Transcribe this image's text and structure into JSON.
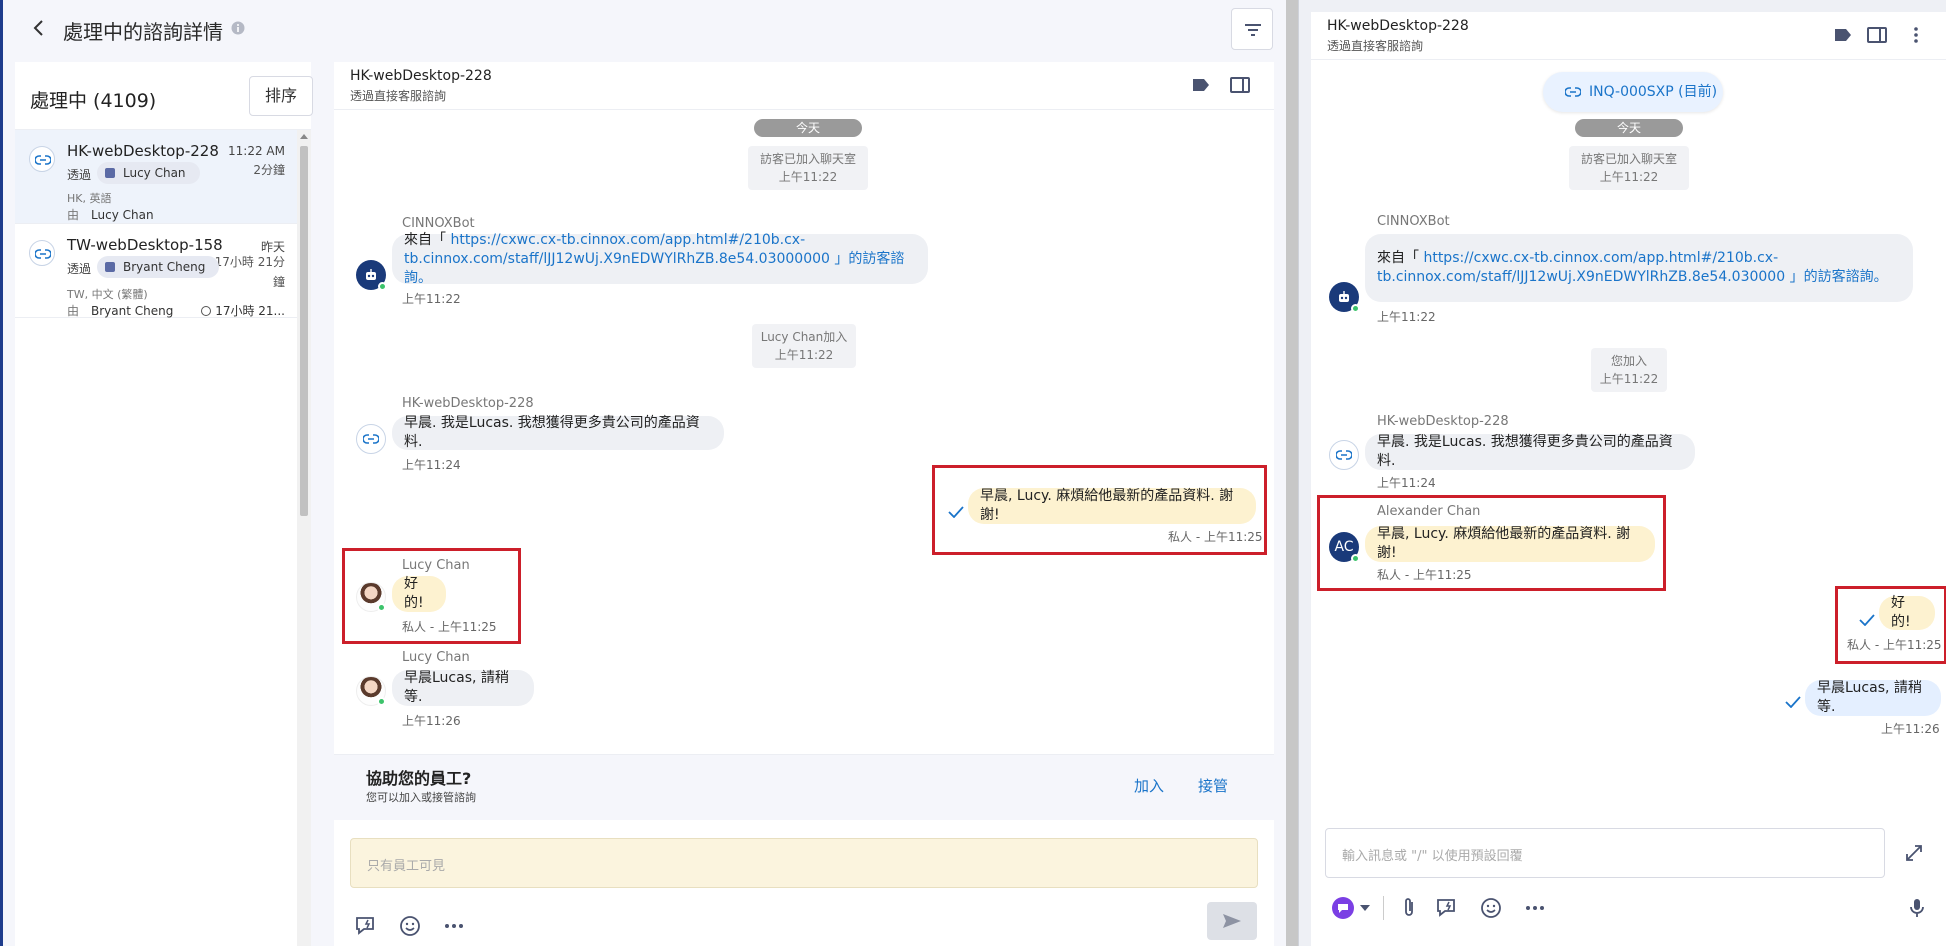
{
  "left_header": {
    "title": "處理中的諮詢詳情"
  },
  "inbox": {
    "title": "處理中 (4109)",
    "sort_label": "排序",
    "items": [
      {
        "name": "HK-webDesktop-228",
        "time": "11:22 AM",
        "duration": "2分鐘",
        "via": "透過",
        "agent": "Lucy Chan",
        "meta": "HK, 英語",
        "by": "由",
        "owner": "Lucy Chan"
      },
      {
        "name": "TW-webDesktop-158",
        "time": "昨天",
        "duration_line1": "17小時 21分",
        "duration_line2": "鐘",
        "via": "透過",
        "agent": "Bryant Cheng",
        "meta": "TW, 中文 (繁體)",
        "by": "由",
        "owner": "Bryant Cheng",
        "wait": "17小時 21..."
      }
    ]
  },
  "mid_chat": {
    "name": "HK-webDesktop-228",
    "sub": "透過直接客服諮詢",
    "date_pill": "今天",
    "sys_join_line1": "訪客已加入聊天室",
    "sys_join_line2": "上午11:22",
    "bot_name": "CINNOXBot",
    "bot_prefix": "來自「 ",
    "bot_link_line1": "https://cxwc.cx-tb.cinnox.com/app.html#/210b.cx-",
    "bot_link_line2": "tb.cinnox.com/staff/lJJ12wUj.X9nEDWYlRhZB.8e54.03000000",
    "bot_suffix": " 」的訪客諮詢。",
    "bot_time": "上午11:22",
    "sys_lucy_line1": "Lucy Chan加入",
    "sys_lucy_line2": "上午11:22",
    "visitor_name": "HK-webDesktop-228",
    "visitor_msg": "早晨. 我是Lucas. 我想獲得更多貴公司的產品資料.",
    "visitor_time": "上午11:24",
    "own_msg": "早晨, Lucy. 麻煩給他最新的產品資料. 謝謝!",
    "own_time": "私人 - 上午11:25",
    "lucy_name": "Lucy Chan",
    "lucy_msg1": "好的!",
    "lucy_time1": "私人 - 上午11:25",
    "lucy_name2": "Lucy Chan",
    "lucy_msg2": "早晨Lucas, 請稍等.",
    "lucy_time2": "上午11:26",
    "assist_title": "協助您的員工?",
    "assist_sub": "您可以加入或接管諮詢",
    "join_label": "加入",
    "takeover_label": "接管",
    "staff_placeholder": "只有員工可見"
  },
  "right_chat": {
    "name": "HK-webDesktop-228",
    "sub": "透過直接客服諮詢",
    "inq_label": "INQ-000SXP (目前)",
    "date_pill": "今天",
    "sys_join_line1": "訪客已加入聊天室",
    "sys_join_line2": "上午11:22",
    "bot_name": "CINNOXBot",
    "bot_prefix": "來自「 ",
    "bot_link_line1": "https://cxwc.cx-tb.cinnox.com/app.html#/210b.cx-",
    "bot_link_line2": "tb.cinnox.com/staff/lJJ12wUj.X9nEDWYlRhZB.8e54.030000",
    "bot_suffix": " 」的訪客諮詢。",
    "bot_time": "上午11:22",
    "sys_you_line1": "您加入",
    "sys_you_line2": "上午11:22",
    "visitor_name": "HK-webDesktop-228",
    "visitor_msg": "早晨. 我是Lucas. 我想獲得更多貴公司的產品資料.",
    "visitor_time": "上午11:24",
    "ac_initials": "AC",
    "ac_name": "Alexander Chan",
    "ac_msg": "早晨, Lucy. 麻煩給他最新的產品資料. 謝謝!",
    "ac_time": "私人 - 上午11:25",
    "own_msg1": "好的!",
    "own_time1": "私人 - 上午11:25",
    "own_msg2": "早晨Lucas, 請稍等.",
    "own_time2": "上午11:26",
    "input_placeholder": "輸入訊息或 \"/\" 以使用預設回覆"
  },
  "colors": {
    "accent": "#1a74c9",
    "navy": "#1a3a7a",
    "highlight_box": "#cc1f2a",
    "private_bubble": "#fdf2d0",
    "online": "#3cc36b"
  }
}
